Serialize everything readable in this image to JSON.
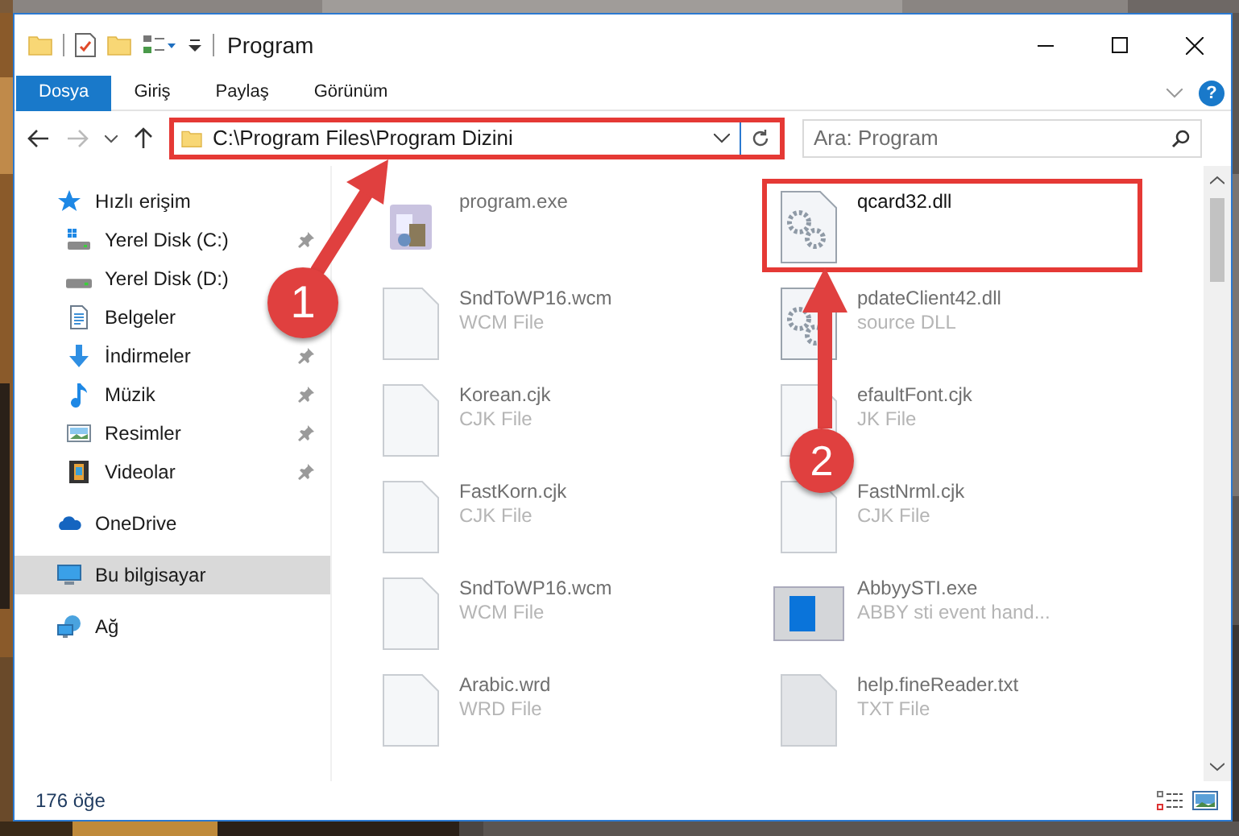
{
  "window": {
    "title": "Program"
  },
  "ribbon": {
    "tabs": [
      {
        "label": "Dosya",
        "selected": true
      },
      {
        "label": "Giriş",
        "selected": false
      },
      {
        "label": "Paylaş",
        "selected": false
      },
      {
        "label": "Görünüm",
        "selected": false
      }
    ],
    "help": "?"
  },
  "address": {
    "path": "C:\\Program Files\\Program Dizini",
    "highlighted": true
  },
  "search": {
    "placeholder": "Ara: Program"
  },
  "sidebar": {
    "items": [
      {
        "label": "Hızlı erişim",
        "kind": "star",
        "selected": false,
        "children": [
          {
            "label": "Yerel Disk (C:)",
            "kind": "drive-win",
            "pinned": true,
            "selected": false
          },
          {
            "label": "Yerel Disk (D:)",
            "kind": "drive",
            "pinned": false,
            "selected": false
          },
          {
            "label": "Belgeler",
            "kind": "docs",
            "pinned": false,
            "selected": false
          },
          {
            "label": "İndirmeler",
            "kind": "download",
            "pinned": true,
            "selected": false
          },
          {
            "label": "Müzik",
            "kind": "music",
            "pinned": true,
            "selected": false
          },
          {
            "label": "Resimler",
            "kind": "pictures",
            "pinned": true,
            "selected": false
          },
          {
            "label": "Videolar",
            "kind": "video",
            "pinned": true,
            "selected": false
          }
        ]
      },
      {
        "label": "OneDrive",
        "kind": "cloud",
        "selected": false
      },
      {
        "label": "Bu bilgisayar",
        "kind": "pc",
        "selected": true
      },
      {
        "label": "Ağ",
        "kind": "network",
        "selected": false
      }
    ]
  },
  "files": [
    {
      "name": "program.exe",
      "kind": "exe",
      "highlighted": false,
      "blurred": true
    },
    {
      "name": "qcard32.dll",
      "kind": "dll",
      "highlighted": true,
      "blurred": false
    },
    {
      "name": "SndToWP16.wcm",
      "type": "WCM File",
      "kind": "blank",
      "highlighted": false,
      "blurred": true
    },
    {
      "name": "pdateClient42.dll",
      "type": "source DLL",
      "kind": "dll",
      "highlighted": false,
      "blurred": true
    },
    {
      "name": "Korean.cjk",
      "type": "CJK File",
      "kind": "blank",
      "highlighted": false,
      "blurred": true
    },
    {
      "name": "efaultFont.cjk",
      "type": "JK File",
      "kind": "blank",
      "highlighted": false,
      "blurred": true
    },
    {
      "name": "FastKorn.cjk",
      "type": "CJK File",
      "kind": "blank",
      "highlighted": false,
      "blurred": true
    },
    {
      "name": "FastNrml.cjk",
      "type": "CJK File",
      "kind": "blank",
      "highlighted": false,
      "blurred": true
    },
    {
      "name": "SndToWP16.wcm",
      "type": "WCM File",
      "kind": "blank",
      "highlighted": false,
      "blurred": true
    },
    {
      "name": "AbbyySTI.exe",
      "type": "ABBY sti event hand...",
      "kind": "app",
      "highlighted": false,
      "blurred": true
    },
    {
      "name": "Arabic.wrd",
      "type": "WRD File",
      "kind": "blank",
      "highlighted": false,
      "blurred": true
    },
    {
      "name": "help.fineReader.txt",
      "type": "TXT File",
      "kind": "txt",
      "highlighted": false,
      "blurred": true
    }
  ],
  "status_bar": {
    "count": "176 öğe"
  },
  "annotations": [
    {
      "number": "1"
    },
    {
      "number": "2"
    }
  ]
}
